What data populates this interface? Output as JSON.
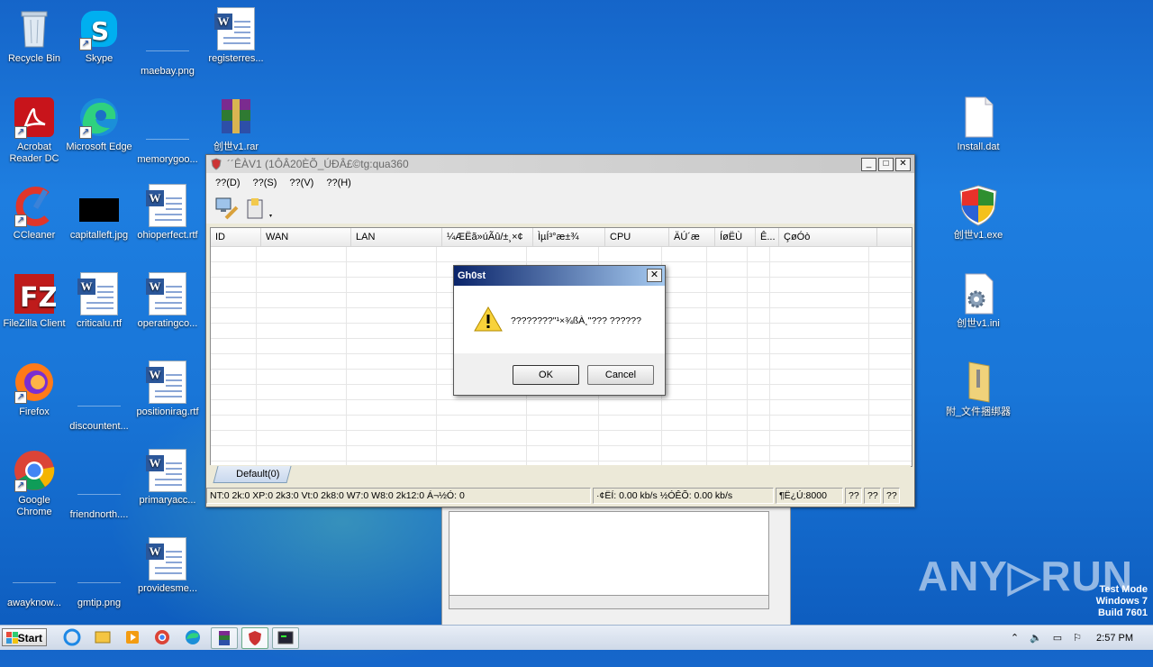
{
  "desktop": {
    "icons": [
      {
        "label": "Recycle Bin"
      },
      {
        "label": "Skype"
      },
      {
        "label": "maebay.png"
      },
      {
        "label": "registerres..."
      },
      {
        "label": "Acrobat Reader DC"
      },
      {
        "label": "Microsoft Edge"
      },
      {
        "label": "memorygoo..."
      },
      {
        "label": "创世v1.rar"
      },
      {
        "label": "CCleaner"
      },
      {
        "label": "capitalleft.jpg"
      },
      {
        "label": "ohioperfect.rtf"
      },
      {
        "label": "FileZilla Client"
      },
      {
        "label": "criticalu.rtf"
      },
      {
        "label": "operatingco..."
      },
      {
        "label": "Firefox"
      },
      {
        "label": "discountent..."
      },
      {
        "label": "positionirag.rtf"
      },
      {
        "label": "Google Chrome"
      },
      {
        "label": "friendnorth...."
      },
      {
        "label": "primaryacc..."
      },
      {
        "label": "awayknow..."
      },
      {
        "label": "gmtip.png"
      },
      {
        "label": "providesme..."
      },
      {
        "label": "Install.dat"
      },
      {
        "label": "创世v1.exe"
      },
      {
        "label": "创世v1.ini"
      },
      {
        "label": "附_文件捆绑器"
      }
    ]
  },
  "window": {
    "title": "´´ÊÀV1 (1ÔÂ20ÈÕ_ÚÐÂ£©tg:qua360",
    "menu": [
      "??(D)",
      "??(S)",
      "??(V)",
      "??(H)"
    ],
    "columns": [
      "ID",
      "WAN",
      "LAN",
      "¼ÆËã»úÃû/±¸×¢",
      "ÌµÍ³°æ±¾",
      "CPU",
      "ÄÚ´æ",
      "ÍøËÙ",
      "Ê...",
      "ÇøÓò"
    ],
    "tab_label": "Default(0)",
    "status": {
      "systems": "NT:0 2k:0 XP:0 2k3:0 Vt:0 2k8:0 W7:0 W8:0 2k12:0  Á¬½Ó: 0",
      "speed": "·¢ËÍ: 0.00 kb/s ½ÓÊÕ: 0.00 kb/s",
      "port": "¶Ë¿Ú:8000",
      "extra1": "??",
      "extra2": "??",
      "extra3": "??"
    }
  },
  "dialog": {
    "title": "Gh0st",
    "message": "????????\"¹×¾ßÀ¸\"??? ??????",
    "ok": "OK",
    "cancel": "Cancel",
    "close": "✕"
  },
  "taskbar": {
    "start": "Start",
    "clock": "2:57 PM"
  },
  "watermark": {
    "brand": "ANY▷RUN",
    "mode": "Test Mode",
    "os": "Windows 7",
    "build": "Build 7601"
  },
  "colors": {
    "desktop": "#1976d8",
    "dialog_title": "#0a246a",
    "window_bg": "#ece9d8"
  }
}
